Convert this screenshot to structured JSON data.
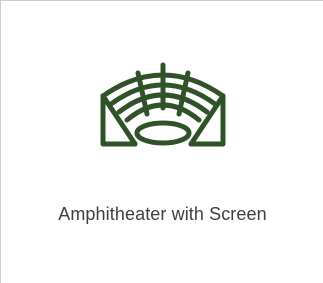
{
  "card": {
    "label": "Amphitheater with Screen",
    "icon": "amphitheater-icon",
    "icon_color": "#2f5228"
  }
}
